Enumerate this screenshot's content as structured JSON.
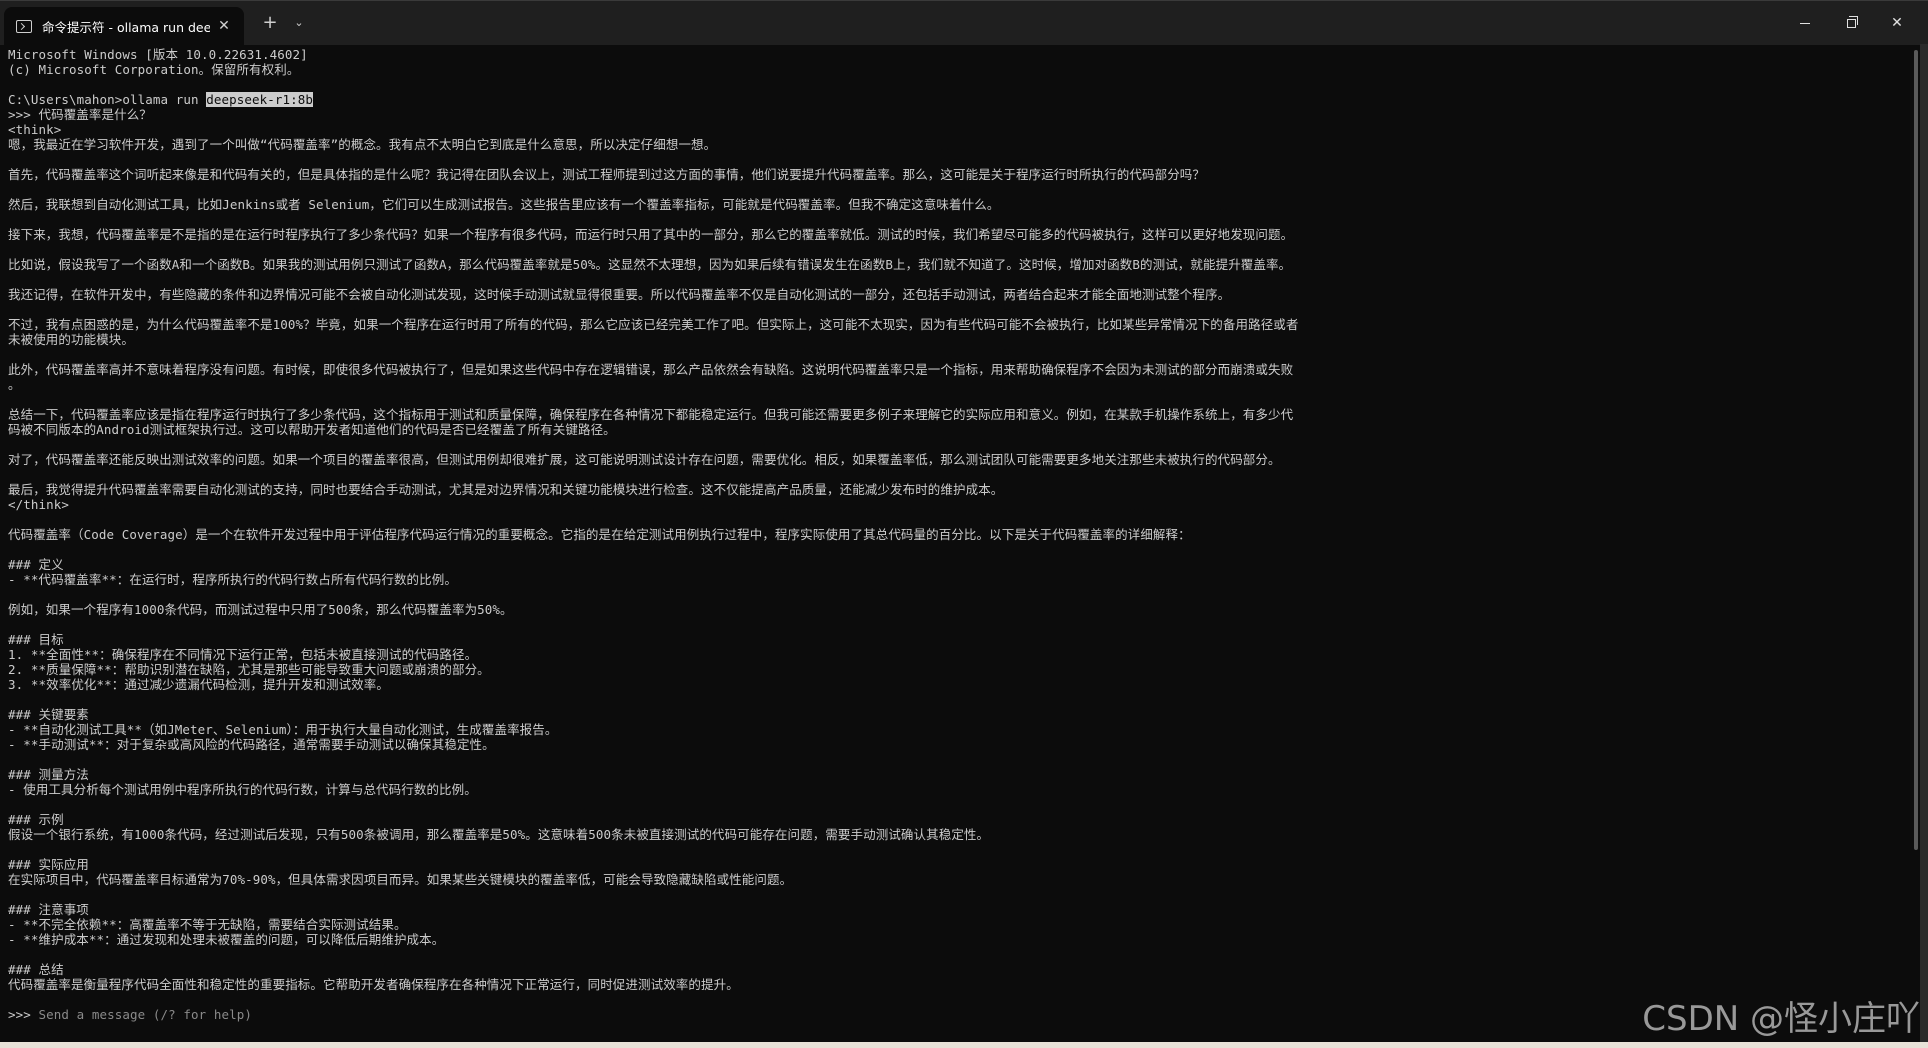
{
  "tab": {
    "title": "命令提示符 - ollama  run deep",
    "close": "✕",
    "new_tab": "+",
    "dropdown": "⌄"
  },
  "window_controls": {
    "minimize": "minimize",
    "maximize": "restore",
    "close": "✕"
  },
  "terminal": {
    "header_1": "Microsoft Windows [版本 10.0.22631.4602]",
    "header_2": "(c) Microsoft Corporation。保留所有权利。",
    "cmd_prefix": "C:\\Users\\mahon>ollama run ",
    "cmd_model": "deepseek-r1:8b",
    "user_question": ">>> 代码覆盖率是什么？",
    "think_open": "<think>",
    "think_lines": [
      "嗯，我最近在学习软件开发，遇到了一个叫做“代码覆盖率”的概念。我有点不太明白它到底是什么意思，所以决定仔细想一想。",
      "",
      "首先，代码覆盖率这个词听起来像是和代码有关的，但是具体指的是什么呢？我记得在团队会议上，测试工程师提到过这方面的事情，他们说要提升代码覆盖率。那么，这可能是关于程序运行时所执行的代码部分吗？",
      "",
      "然后，我联想到自动化测试工具，比如Jenkins或者 Selenium，它们可以生成测试报告。这些报告里应该有一个覆盖率指标，可能就是代码覆盖率。但我不确定这意味着什么。",
      "",
      "接下来，我想，代码覆盖率是不是指的是在运行时程序执行了多少条代码？如果一个程序有很多代码，而运行时只用了其中的一部分，那么它的覆盖率就低。测试的时候，我们希望尽可能多的代码被执行，这样可以更好地发现问题。",
      "",
      "比如说，假设我写了一个函数A和一个函数B。如果我的测试用例只测试了函数A，那么代码覆盖率就是50%。这显然不太理想，因为如果后续有错误发生在函数B上，我们就不知道了。这时候，增加对函数B的测试，就能提升覆盖率。",
      "",
      "我还记得，在软件开发中，有些隐藏的条件和边界情况可能不会被自动化测试发现，这时候手动测试就显得很重要。所以代码覆盖率不仅是自动化测试的一部分，还包括手动测试，两者结合起来才能全面地测试整个程序。",
      "",
      "不过，我有点困惑的是，为什么代码覆盖率不是100%？毕竟，如果一个程序在运行时用了所有的代码，那么它应该已经完美工作了吧。但实际上，这可能不太现实，因为有些代码可能不会被执行，比如某些异常情况下的备用路径或者",
      "未被使用的功能模块。",
      "",
      "此外，代码覆盖率高并不意味着程序没有问题。有时候，即使很多代码被执行了，但是如果这些代码中存在逻辑错误，那么产品依然会有缺陷。这说明代码覆盖率只是一个指标，用来帮助确保程序不会因为未测试的部分而崩溃或失败",
      "。",
      "",
      "总结一下，代码覆盖率应该是指在程序运行时执行了多少条代码，这个指标用于测试和质量保障，确保程序在各种情况下都能稳定运行。但我可能还需要更多例子来理解它的实际应用和意义。例如，在某款手机操作系统上，有多少代",
      "码被不同版本的Android测试框架执行过。这可以帮助开发者知道他们的代码是否已经覆盖了所有关键路径。",
      "",
      "对了，代码覆盖率还能反映出测试效率的问题。如果一个项目的覆盖率很高，但测试用例却很难扩展，这可能说明测试设计存在问题，需要优化。相反，如果覆盖率低，那么测试团队可能需要更多地关注那些未被执行的代码部分。",
      "",
      "最后，我觉得提升代码覆盖率需要自动化测试的支持，同时也要结合手动测试，尤其是对边界情况和关键功能模块进行检查。这不仅能提高产品质量，还能减少发布时的维护成本。"
    ],
    "think_close": "</think>",
    "answer_lines": [
      "代码覆盖率（Code Coverage）是一个在软件开发过程中用于评估程序代码运行情况的重要概念。它指的是在给定测试用例执行过程中，程序实际使用了其总代码量的百分比。以下是关于代码覆盖率的详细解释：",
      "",
      "### 定义",
      "- **代码覆盖率**：在运行时，程序所执行的代码行数占所有代码行数的比例。",
      "",
      "例如，如果一个程序有1000条代码，而测试过程中只用了500条，那么代码覆盖率为50%。",
      "",
      "### 目标",
      "1. **全面性**：确保程序在不同情况下运行正常，包括未被直接测试的代码路径。",
      "2. **质量保障**：帮助识别潜在缺陷，尤其是那些可能导致重大问题或崩溃的部分。",
      "3. **效率优化**：通过减少遗漏代码检测，提升开发和测试效率。",
      "",
      "### 关键要素",
      "- **自动化测试工具**（如JMeter、Selenium）：用于执行大量自动化测试，生成覆盖率报告。",
      "- **手动测试**：对于复杂或高风险的代码路径，通常需要手动测试以确保其稳定性。",
      "",
      "### 测量方法",
      "- 使用工具分析每个测试用例中程序所执行的代码行数，计算与总代码行数的比例。",
      "",
      "### 示例",
      "假设一个银行系统，有1000条代码，经过测试后发现，只有500条被调用，那么覆盖率是50%。这意味着500条未被直接测试的代码可能存在问题，需要手动测试确认其稳定性。",
      "",
      "### 实际应用",
      "在实际项目中，代码覆盖率目标通常为70%-90%，但具体需求因项目而异。如果某些关键模块的覆盖率低，可能会导致隐藏缺陷或性能问题。",
      "",
      "### 注意事项",
      "- **不完全依赖**：高覆盖率不等于无缺陷，需要结合实际测试结果。",
      "- **维护成本**：通过发现和处理未被覆盖的问题，可以降低后期维护成本。",
      "",
      "### 总结",
      "代码覆盖率是衡量程序代码全面性和稳定性的重要指标。它帮助开发者确保程序在各种情况下正常运行，同时促进测试效率的提升。"
    ],
    "prompt_marker": ">>> ",
    "prompt_placeholder": "Send a message (/? for help)"
  },
  "watermark": "CSDN @怪小庄吖"
}
